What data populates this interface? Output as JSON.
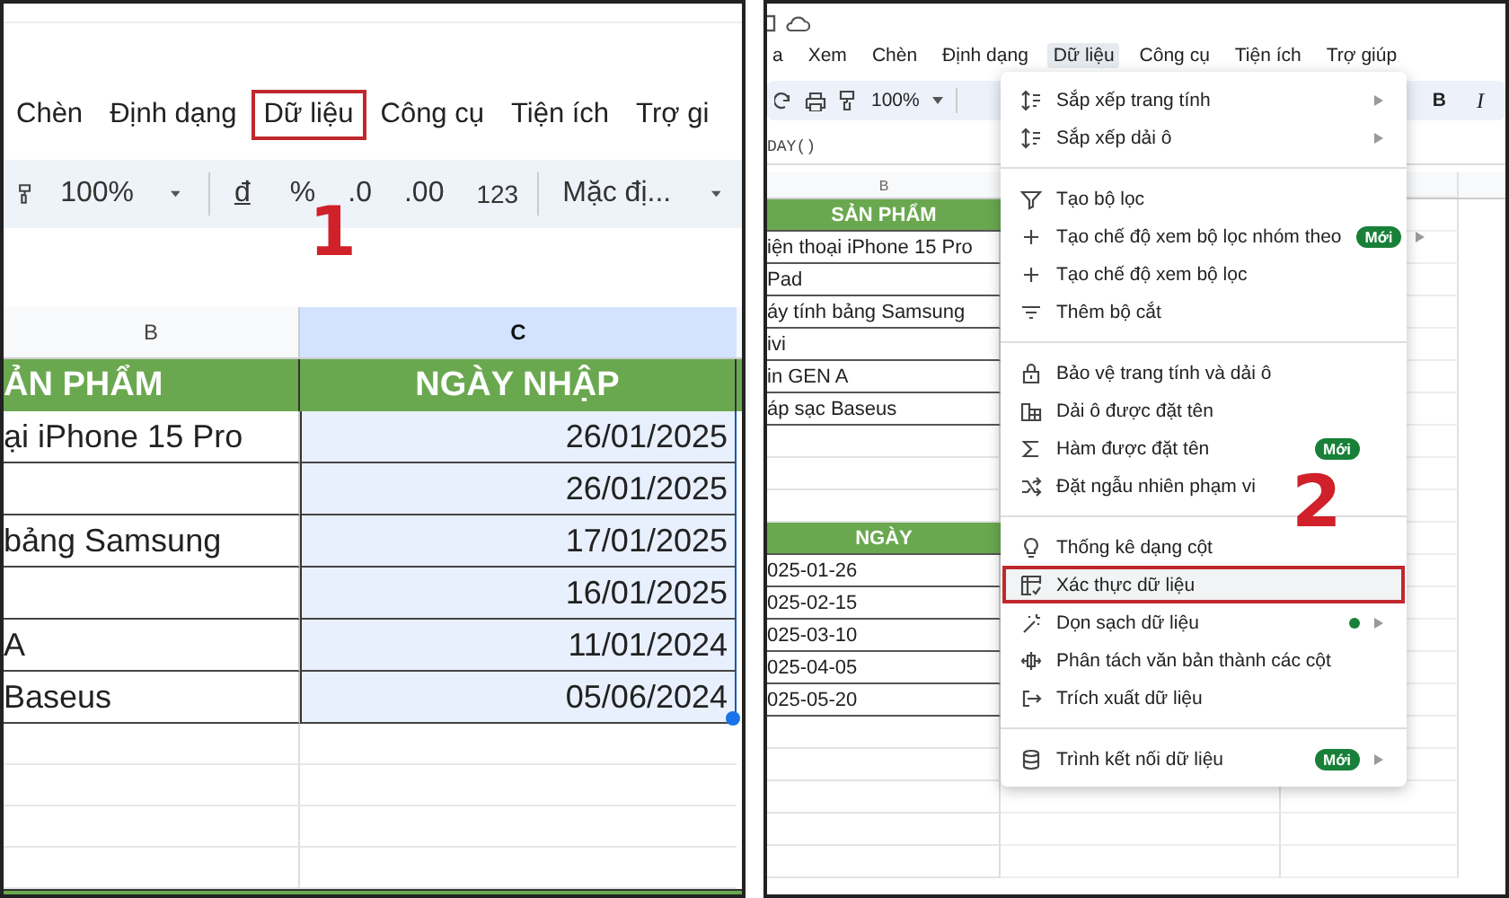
{
  "left_panel": {
    "menu": [
      {
        "label": "Chèn",
        "selected": false
      },
      {
        "label": "Định dạng",
        "selected": false
      },
      {
        "label": "Dữ liệu",
        "selected": true
      },
      {
        "label": "Công cụ",
        "selected": false
      },
      {
        "label": "Tiện ích",
        "selected": false
      },
      {
        "label": "Trợ gi",
        "selected": false
      }
    ],
    "toolbar": {
      "zoom": "100%",
      "currency": "đ",
      "percent": "%",
      "decrease_decimal": ".0",
      "increase_decimal": ".00",
      "number_format": "123",
      "font": "Mặc đị..."
    },
    "step": "1",
    "columns": [
      {
        "label": "B",
        "selected": false
      },
      {
        "label": "C",
        "selected": true
      }
    ],
    "header": [
      "ẢN PHẨM",
      "NGÀY NHẬP"
    ],
    "rows": [
      {
        "product": "ại iPhone 15 Pro",
        "date": "26/01/2025"
      },
      {
        "date": "26/01/2025"
      },
      {
        "product": "bảng Samsung",
        "date": "17/01/2025"
      },
      {
        "date": "16/01/2025"
      },
      {
        "product": "A",
        "date": "11/01/2024"
      },
      {
        "product": "Baseus",
        "date": "05/06/2024"
      }
    ]
  },
  "right_panel": {
    "menu": [
      {
        "label": "a",
        "selected": false
      },
      {
        "label": "Xem",
        "selected": false
      },
      {
        "label": "Chèn",
        "selected": false
      },
      {
        "label": "Định dạng",
        "selected": false
      },
      {
        "label": "Dữ liệu",
        "selected": true
      },
      {
        "label": "Công cụ",
        "selected": false
      },
      {
        "label": "Tiện ích",
        "selected": false
      },
      {
        "label": "Trợ giúp",
        "selected": false
      }
    ],
    "toolbar": {
      "zoom": "100%",
      "bold": "B",
      "italic": "I"
    },
    "formula": "DAY()",
    "column": "B",
    "cells": [
      {
        "kind": "header",
        "text": "SẢN PHẨM"
      },
      {
        "kind": "cell",
        "text": "iện thoại iPhone 15 Pro"
      },
      {
        "kind": "cell",
        "text": "Pad"
      },
      {
        "kind": "cell",
        "text": "áy tính bảng Samsung"
      },
      {
        "kind": "cell",
        "text": "ivi"
      },
      {
        "kind": "cell",
        "text": "in GEN A"
      },
      {
        "kind": "cell",
        "text": "áp sạc Baseus"
      },
      {
        "kind": "blank"
      },
      {
        "kind": "blank"
      },
      {
        "kind": "blank"
      },
      {
        "kind": "header",
        "text": "NGÀY"
      },
      {
        "kind": "cell",
        "text": "025-01-26"
      },
      {
        "kind": "cell",
        "text": "025-02-15"
      },
      {
        "kind": "cell",
        "text": "025-03-10"
      },
      {
        "kind": "cell",
        "text": "025-04-05"
      },
      {
        "kind": "cell",
        "text": "025-05-20"
      }
    ],
    "dropdown": [
      [
        {
          "label": "Sắp xếp trang tính",
          "submenu": true,
          "selected": false
        },
        {
          "label": "Sắp xếp dải ô",
          "submenu": true,
          "selected": false
        }
      ],
      [
        {
          "label": "Tạo bộ lọc",
          "submenu": false,
          "selected": false
        },
        {
          "label": "Tạo chế độ xem bộ lọc nhóm theo",
          "badge": "Mới",
          "submenu": true,
          "selected": false
        },
        {
          "label": "Tạo chế độ xem bộ lọc",
          "submenu": false,
          "selected": false
        },
        {
          "label": "Thêm bộ cắt",
          "submenu": false,
          "selected": false
        }
      ],
      [
        {
          "label": "Bảo vệ trang tính và dải ô",
          "submenu": false,
          "selected": false
        },
        {
          "label": "Dải ô được đặt tên",
          "submenu": false,
          "selected": false
        },
        {
          "label": "Hàm được đặt tên",
          "badge": "Mới",
          "submenu": false,
          "selected": false
        },
        {
          "label": "Đặt ngẫu nhiên phạm vi",
          "submenu": false,
          "selected": false
        }
      ],
      [
        {
          "label": "Thống kê dạng cột",
          "submenu": false,
          "selected": false
        },
        {
          "label": "Xác thực dữ liệu",
          "submenu": false,
          "selected": true
        },
        {
          "label": "Dọn sạch dữ liệu",
          "dot": true,
          "submenu": true,
          "selected": false
        },
        {
          "label": "Phân tách văn bản thành các cột",
          "submenu": false,
          "selected": false
        },
        {
          "label": "Trích xuất dữ liệu",
          "submenu": false,
          "selected": false
        }
      ],
      [
        {
          "label": "Trình kết nối dữ liệu",
          "badge": "Mới",
          "submenu": true,
          "selected": false
        }
      ]
    ],
    "step": "2"
  }
}
